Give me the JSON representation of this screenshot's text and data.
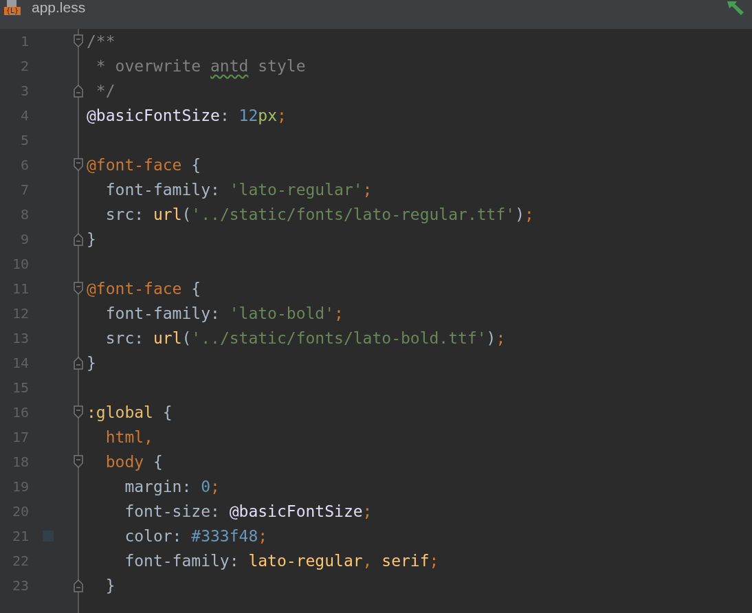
{
  "tab": {
    "icon_label": "{L}",
    "title": "app.less"
  },
  "lines": [
    {
      "number": "1",
      "fold_start": true,
      "tokens": [
        {
          "kind": "comment",
          "text": "/**"
        }
      ]
    },
    {
      "number": "2",
      "tokens": [
        {
          "kind": "comment",
          "text": " * overwrite "
        },
        {
          "kind": "comment",
          "text": "antd",
          "typo": true
        },
        {
          "kind": "comment",
          "text": " style"
        }
      ]
    },
    {
      "number": "3",
      "fold_end": true,
      "tokens": [
        {
          "kind": "comment",
          "text": " */"
        }
      ]
    },
    {
      "number": "4",
      "tokens": [
        {
          "kind": "variable",
          "text": "@basicFontSize"
        },
        {
          "kind": "plain",
          "text": ": "
        },
        {
          "kind": "number",
          "text": "12"
        },
        {
          "kind": "unit",
          "text": "px"
        },
        {
          "kind": "punct",
          "text": ";"
        }
      ]
    },
    {
      "number": "5"
    },
    {
      "number": "6",
      "fold_start": true,
      "tokens": [
        {
          "kind": "atrule",
          "text": "@font-face"
        },
        {
          "kind": "plain",
          "text": " {"
        }
      ]
    },
    {
      "number": "7",
      "tokens": [
        {
          "kind": "plain",
          "text": "  font-family: "
        },
        {
          "kind": "string",
          "text": "'lato-regular'"
        },
        {
          "kind": "punct",
          "text": ";"
        }
      ]
    },
    {
      "number": "8",
      "tokens": [
        {
          "kind": "plain",
          "text": "  src: "
        },
        {
          "kind": "function",
          "text": "url"
        },
        {
          "kind": "plain",
          "text": "("
        },
        {
          "kind": "string",
          "text": "'../static/fonts/lato-regular.ttf'"
        },
        {
          "kind": "plain",
          "text": ")"
        },
        {
          "kind": "punct",
          "text": ";"
        }
      ]
    },
    {
      "number": "9",
      "fold_end": true,
      "tokens": [
        {
          "kind": "plain",
          "text": "}"
        }
      ]
    },
    {
      "number": "10"
    },
    {
      "number": "11",
      "fold_start": true,
      "tokens": [
        {
          "kind": "atrule",
          "text": "@font-face"
        },
        {
          "kind": "plain",
          "text": " {"
        }
      ]
    },
    {
      "number": "12",
      "tokens": [
        {
          "kind": "plain",
          "text": "  font-family: "
        },
        {
          "kind": "string",
          "text": "'lato-bold'"
        },
        {
          "kind": "punct",
          "text": ";"
        }
      ]
    },
    {
      "number": "13",
      "tokens": [
        {
          "kind": "plain",
          "text": "  src: "
        },
        {
          "kind": "function",
          "text": "url"
        },
        {
          "kind": "plain",
          "text": "("
        },
        {
          "kind": "string",
          "text": "'../static/fonts/lato-bold.ttf'"
        },
        {
          "kind": "plain",
          "text": ")"
        },
        {
          "kind": "punct",
          "text": ";"
        }
      ]
    },
    {
      "number": "14",
      "fold_end": true,
      "tokens": [
        {
          "kind": "plain",
          "text": "}"
        }
      ]
    },
    {
      "number": "15"
    },
    {
      "number": "16",
      "fold_start": true,
      "tokens": [
        {
          "kind": "pseudo",
          "text": ":global"
        },
        {
          "kind": "plain",
          "text": " {"
        }
      ]
    },
    {
      "number": "17",
      "tokens": [
        {
          "kind": "selector",
          "text": "  html,"
        }
      ]
    },
    {
      "number": "18",
      "fold_start": true,
      "tokens": [
        {
          "kind": "selector",
          "text": "  body"
        },
        {
          "kind": "plain",
          "text": " {"
        }
      ]
    },
    {
      "number": "19",
      "tokens": [
        {
          "kind": "plain",
          "text": "    margin: "
        },
        {
          "kind": "number",
          "text": "0"
        },
        {
          "kind": "punct",
          "text": ";"
        }
      ]
    },
    {
      "number": "20",
      "tokens": [
        {
          "kind": "plain",
          "text": "    font-size: "
        },
        {
          "kind": "variable",
          "text": "@basicFontSize"
        },
        {
          "kind": "punct",
          "text": ";"
        }
      ]
    },
    {
      "number": "21",
      "color_swatch": true,
      "tokens": [
        {
          "kind": "plain",
          "text": "    color: "
        },
        {
          "kind": "color",
          "text": "#333f48"
        },
        {
          "kind": "punct",
          "text": ";"
        }
      ]
    },
    {
      "number": "22",
      "tokens": [
        {
          "kind": "plain",
          "text": "    font-family: "
        },
        {
          "kind": "function",
          "text": "lato-regular"
        },
        {
          "kind": "punct",
          "text": ", "
        },
        {
          "kind": "function",
          "text": "serif"
        },
        {
          "kind": "punct",
          "text": ";"
        }
      ]
    },
    {
      "number": "23",
      "fold_end": true,
      "tokens": [
        {
          "kind": "plain",
          "text": "  }"
        }
      ]
    }
  ]
}
